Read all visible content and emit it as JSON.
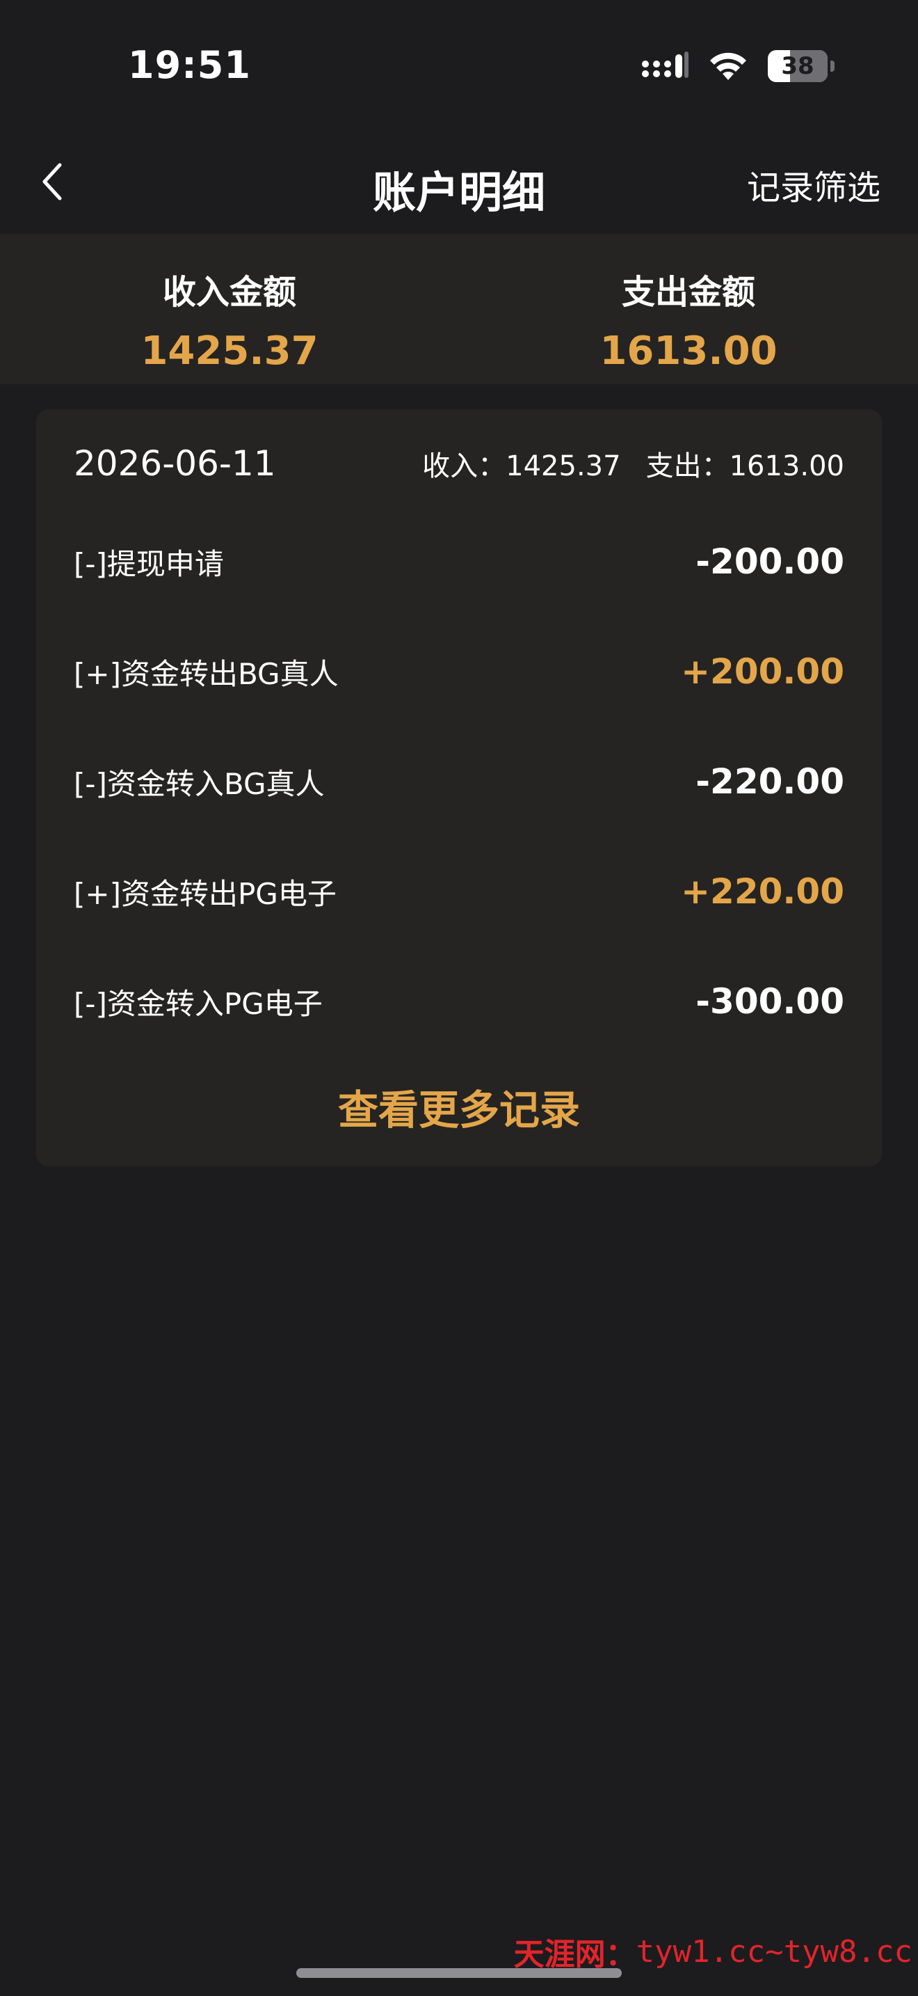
{
  "status_bar": {
    "time": "19:51",
    "battery_level": "38"
  },
  "nav": {
    "title": "账户明细",
    "filter_label": "记录筛选"
  },
  "summary": {
    "income_label": "收入金额",
    "income_value": "1425.37",
    "expense_label": "支出金额",
    "expense_value": "1613.00"
  },
  "card": {
    "date": "2026-06-11",
    "income_text": "收入：1425.37",
    "expense_text": "支出：1613.00",
    "rows": [
      {
        "label": "[-]提现申请",
        "amount": "-200.00"
      },
      {
        "label": "[+]资金转出BG真人",
        "amount": "+200.00"
      },
      {
        "label": "[-]资金转入BG真人",
        "amount": "-220.00"
      },
      {
        "label": "[+]资金转出PG电子",
        "amount": "+220.00"
      },
      {
        "label": "[-]资金转入PG电子",
        "amount": "-300.00"
      }
    ],
    "more_label": "查看更多记录"
  },
  "watermark": {
    "brand": "天涯网：",
    "url": "tyw1.cc~tyw8.cc"
  },
  "colors": {
    "background": "#1c1c1e",
    "panel": "#252422",
    "accent": "#e4a64a"
  }
}
